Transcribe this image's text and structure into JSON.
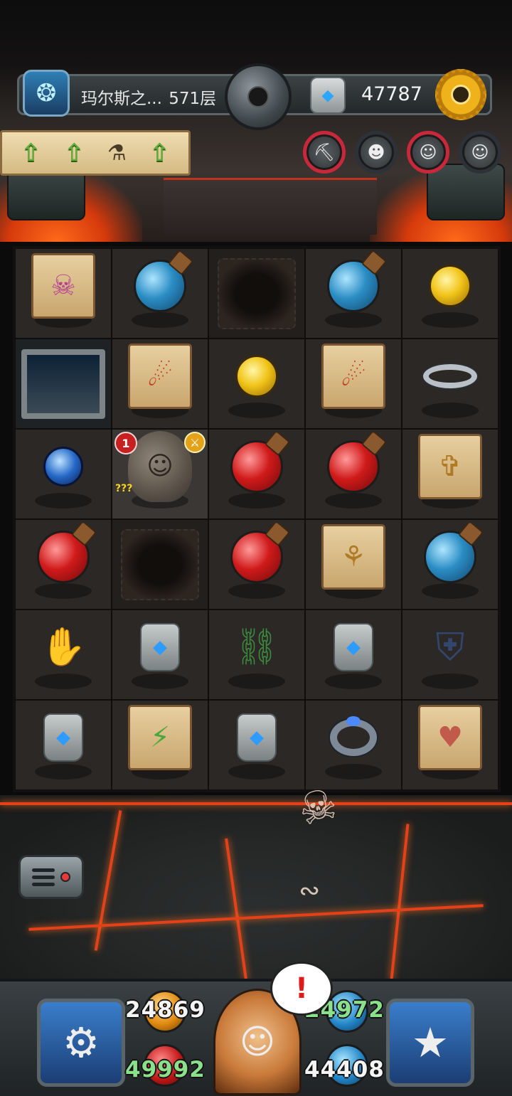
{
  "header": {
    "floor_name": "玛尔斯之...",
    "floor_level": "571层",
    "gold": "47787",
    "bonus_arrows": [
      "up",
      "up",
      "up"
    ]
  },
  "grid": [
    [
      "scroll-skull",
      "potion-blue",
      "hole",
      "potion-blue",
      "orb-yellow"
    ],
    [
      "stairs",
      "scroll-meteor",
      "orb-yellow",
      "scroll-meteor",
      "ring-silver"
    ],
    [
      "orb-blue",
      "monster",
      "potion-red",
      "potion-red",
      "scroll-sword"
    ],
    [
      "potion-red",
      "hole",
      "potion-red",
      "scroll-wings",
      "potion-blue"
    ],
    [
      "gauntlet",
      "rune-stone",
      "boots",
      "rune-stone",
      "armor"
    ],
    [
      "rune-stone",
      "scroll-bolt",
      "rune-stone",
      "ring-jewel",
      "scroll-heart"
    ]
  ],
  "monster": {
    "level": "1",
    "hint": "???"
  },
  "stats": {
    "attack": "24869",
    "hp": "49992",
    "defense": "24972",
    "mp": "44408"
  },
  "alert": "!",
  "colors": {
    "lava": "#e4411a",
    "stat_green": "#8be08b",
    "alert_red": "#e01919"
  }
}
